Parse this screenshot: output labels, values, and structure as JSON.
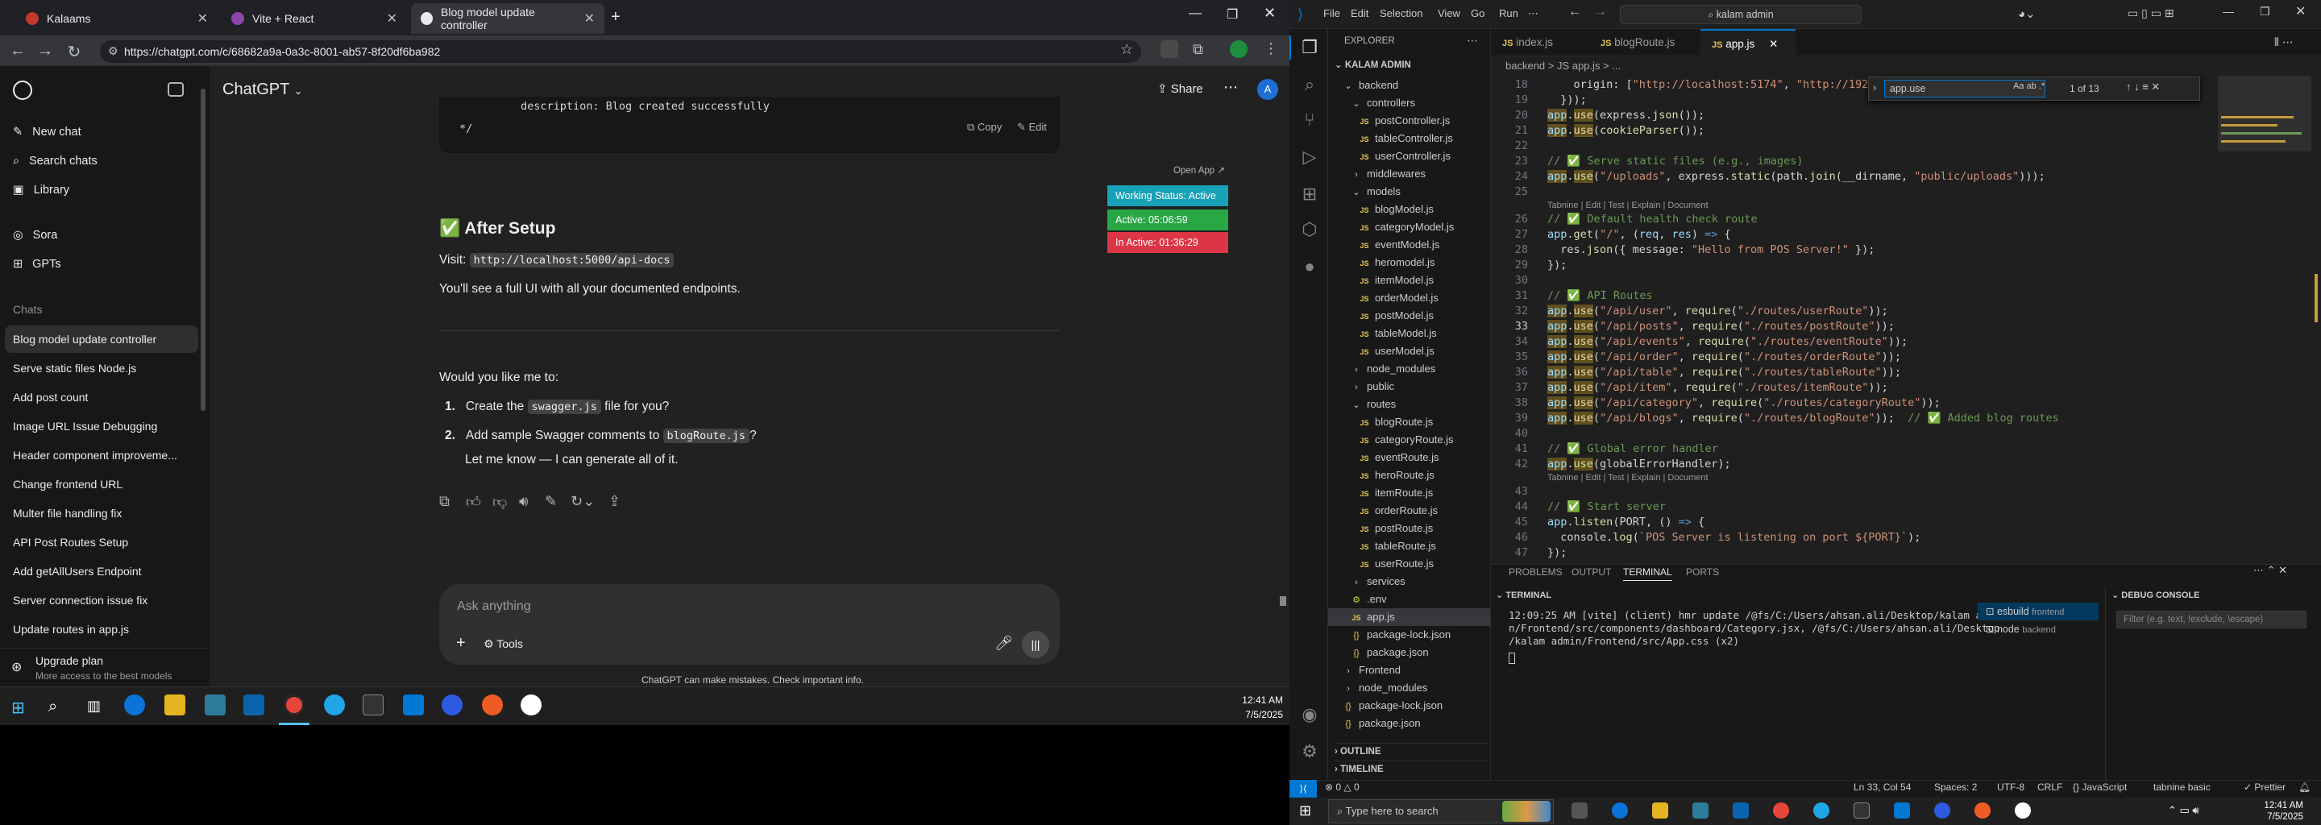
{
  "browser": {
    "tabs": [
      {
        "title": "Kalaams"
      },
      {
        "title": "Vite + React"
      },
      {
        "title": "Blog model update controller"
      }
    ],
    "url": "https://chatgpt.com/c/68682a9a-0a3c-8001-ab57-8f20df6ba982"
  },
  "sidebar": {
    "top_items": [
      {
        "label": "New chat",
        "icon": "compose-icon"
      },
      {
        "label": "Search chats",
        "icon": "search-icon"
      },
      {
        "label": "Library",
        "icon": "library-icon"
      },
      {
        "label": "Sora",
        "icon": "sora-icon"
      },
      {
        "label": "GPTs",
        "icon": "gpts-icon"
      }
    ],
    "section_label": "Chats",
    "chats": [
      "Blog model update controller",
      "Serve static files Node.js",
      "Add post count",
      "Image URL Issue Debugging",
      "Header component improveme...",
      "Change frontend URL",
      "Multer file handling fix",
      "API Post Routes Setup",
      "Add getAllUsers Endpoint",
      "Server connection issue fix",
      "Update routes in app.js"
    ],
    "upgrade_title": "Upgrade plan",
    "upgrade_sub": "More access to the best models"
  },
  "chat": {
    "model": "ChatGPT",
    "share": "Share",
    "code_tail_1": "description: Blog created successfully",
    "code_tail_2": "*/",
    "copy_label": "Copy",
    "edit_label": "Edit",
    "after_setup_title": "After Setup",
    "visit_prefix": "Visit:",
    "visit_url": "http://localhost:5000/api-docs",
    "see_line": "You'll see a full UI with all your documented endpoints.",
    "question": "Would you like me to:",
    "options": [
      {
        "num": "1.",
        "pre": "Create the ",
        "code": "swagger.js",
        "post": " file for you?"
      },
      {
        "num": "2.",
        "pre": "Add sample Swagger comments to ",
        "code": "blogRoute.js",
        "post": "?"
      }
    ],
    "closing": "Let me know — I can generate all of it.",
    "composer_placeholder": "Ask anything",
    "tools_label": "Tools",
    "disclaimer": "ChatGPT can make mistakes. Check important info."
  },
  "status_widget": {
    "open_app": "Open App ↗",
    "working": "Working Status: Active",
    "active": "Active: 05:06:59",
    "inactive": "In Active: 01:36:29"
  },
  "taskbar_left": {
    "time": "12:41 AM",
    "date": "7/5/2025"
  },
  "vscode": {
    "menu": [
      "File",
      "Edit",
      "Selection",
      "View",
      "Go",
      "Run"
    ],
    "search": "kalam admin",
    "explorer_title": "EXPLORER",
    "root": "KALAM ADMIN",
    "tree": [
      {
        "name": "backend",
        "type": "folder-open",
        "depth": 1
      },
      {
        "name": "controllers",
        "type": "folder-open",
        "depth": 2
      },
      {
        "name": "postController.js",
        "type": "js",
        "depth": 3
      },
      {
        "name": "tableController.js",
        "type": "js",
        "depth": 3
      },
      {
        "name": "userController.js",
        "type": "js",
        "depth": 3
      },
      {
        "name": "middlewares",
        "type": "folder",
        "depth": 2
      },
      {
        "name": "models",
        "type": "folder-open",
        "depth": 2
      },
      {
        "name": "blogModel.js",
        "type": "js",
        "depth": 3
      },
      {
        "name": "categoryModel.js",
        "type": "js",
        "depth": 3
      },
      {
        "name": "eventModel.js",
        "type": "js",
        "depth": 3
      },
      {
        "name": "heromodel.js",
        "type": "js",
        "depth": 3
      },
      {
        "name": "itemModel.js",
        "type": "js",
        "depth": 3
      },
      {
        "name": "orderModel.js",
        "type": "js",
        "depth": 3
      },
      {
        "name": "postModel.js",
        "type": "js",
        "depth": 3
      },
      {
        "name": "tableModel.js",
        "type": "js",
        "depth": 3
      },
      {
        "name": "userModel.js",
        "type": "js",
        "depth": 3
      },
      {
        "name": "node_modules",
        "type": "folder",
        "depth": 2
      },
      {
        "name": "public",
        "type": "folder",
        "depth": 2
      },
      {
        "name": "routes",
        "type": "folder-open",
        "depth": 2
      },
      {
        "name": "blogRoute.js",
        "type": "js",
        "depth": 3
      },
      {
        "name": "categoryRoute.js",
        "type": "js",
        "depth": 3
      },
      {
        "name": "eventRoute.js",
        "type": "js",
        "depth": 3
      },
      {
        "name": "heroRoute.js",
        "type": "js",
        "depth": 3
      },
      {
        "name": "itemRoute.js",
        "type": "js",
        "depth": 3
      },
      {
        "name": "orderRoute.js",
        "type": "js",
        "depth": 3
      },
      {
        "name": "postRoute.js",
        "type": "js",
        "depth": 3
      },
      {
        "name": "tableRoute.js",
        "type": "js",
        "depth": 3
      },
      {
        "name": "userRoute.js",
        "type": "js",
        "depth": 3
      },
      {
        "name": "services",
        "type": "folder",
        "depth": 2
      },
      {
        "name": ".env",
        "type": "env",
        "depth": 2
      },
      {
        "name": "app.js",
        "type": "js",
        "depth": 2,
        "selected": true
      },
      {
        "name": "package-lock.json",
        "type": "json",
        "depth": 2
      },
      {
        "name": "package.json",
        "type": "json",
        "depth": 2
      },
      {
        "name": "Frontend",
        "type": "folder",
        "depth": 1
      },
      {
        "name": "node_modules",
        "type": "folder",
        "depth": 1
      },
      {
        "name": "package-lock.json",
        "type": "json",
        "depth": 1
      },
      {
        "name": "package.json",
        "type": "json",
        "depth": 1
      }
    ],
    "outline": "OUTLINE",
    "timeline": "TIMELINE",
    "editor_tabs": [
      "index.js",
      "blogRoute.js",
      "app.js"
    ],
    "breadcrumb": "backend > JS app.js > ...",
    "find_query": "app.use",
    "find_count": "1 of 13",
    "panel_tabs": [
      "PROBLEMS",
      "OUTPUT",
      "TERMINAL",
      "PORTS"
    ],
    "terminals": [
      {
        "name": "esbuild",
        "sub": "frontend"
      },
      {
        "name": "node",
        "sub": "backend"
      }
    ],
    "debug_title": "DEBUG CONSOLE",
    "debug_filter": "Filter (e.g. text, !exclude, \\escape)",
    "terminal_lines": [
      "12:09:25 AM [vite] (client) hmr update /@fs/C:/Users/ahsan.ali/Desktop/kalam admi",
      "n/Frontend/src/components/dashboard/Category.jsx, /@fs/C:/Users/ahsan.ali/Desktop",
      "/kalam admin/Frontend/src/App.css (x2)"
    ],
    "statusbar": {
      "errors": "⊗ 0 △ 0",
      "cursor": "Ln 33, Col 54",
      "spaces": "Spaces: 2",
      "encoding": "UTF-8",
      "eol": "CRLF",
      "lang": "{} JavaScript",
      "tabnine": "tabnine basic",
      "prettier": "✓ Prettier"
    },
    "taskbar": {
      "search": "Type here to search",
      "time": "12:41 AM",
      "date": "7/5/2025"
    }
  },
  "code_lines": [
    {
      "n": "18",
      "spans": [
        [
          "n",
          "    origin: ["
        ],
        [
          "s",
          "\"http://localhost:5174\""
        ],
        [
          "n",
          ", "
        ],
        [
          "s",
          "\"http://192.168"
        ]
      ]
    },
    {
      "n": "19",
      "spans": [
        [
          "n",
          "  }));"
        ]
      ]
    },
    {
      "n": "20",
      "spans": [
        [
          "v",
          "app"
        ],
        [
          "n",
          "."
        ],
        [
          "f",
          "use"
        ],
        [
          "n",
          "(express."
        ],
        [
          "f",
          "json"
        ],
        [
          "n",
          "());"
        ]
      ]
    },
    {
      "n": "21",
      "spans": [
        [
          "v",
          "app"
        ],
        [
          "n",
          "."
        ],
        [
          "f",
          "use"
        ],
        [
          "n",
          "("
        ],
        [
          "f",
          "cookieParser"
        ],
        [
          "n",
          "());"
        ]
      ]
    },
    {
      "n": "22",
      "spans": [
        [
          "n",
          ""
        ]
      ]
    },
    {
      "n": "23",
      "spans": [
        [
          "c",
          "// ✅ Serve static files (e.g., images)"
        ]
      ]
    },
    {
      "n": "24",
      "spans": [
        [
          "v",
          "app"
        ],
        [
          "n",
          "."
        ],
        [
          "f",
          "use"
        ],
        [
          "n",
          "("
        ],
        [
          "s",
          "\"/uploads\""
        ],
        [
          "n",
          ", express."
        ],
        [
          "f",
          "static"
        ],
        [
          "n",
          "(path."
        ],
        [
          "f",
          "join"
        ],
        [
          "n",
          "(__dirname, "
        ],
        [
          "s",
          "\"public/uploads\""
        ],
        [
          "n",
          ")));"
        ]
      ]
    },
    {
      "n": "25",
      "spans": [
        [
          "n",
          ""
        ]
      ]
    },
    {
      "n": "26",
      "spans": [
        [
          "c",
          "// ✅ Default health check route"
        ]
      ]
    },
    {
      "n": "27",
      "spans": [
        [
          "v",
          "app"
        ],
        [
          "n",
          "."
        ],
        [
          "f",
          "get"
        ],
        [
          "n",
          "("
        ],
        [
          "s",
          "\"/\""
        ],
        [
          "n",
          ", ("
        ],
        [
          "v",
          "req"
        ],
        [
          "n",
          ", "
        ],
        [
          "v",
          "res"
        ],
        [
          "n",
          ") "
        ],
        [
          "k",
          "=>"
        ],
        [
          "n",
          " {"
        ]
      ]
    },
    {
      "n": "28",
      "spans": [
        [
          "n",
          "  res."
        ],
        [
          "f",
          "json"
        ],
        [
          "n",
          "({ message: "
        ],
        [
          "s",
          "\"Hello from POS Server!\""
        ],
        [
          "n",
          " });"
        ]
      ]
    },
    {
      "n": "29",
      "spans": [
        [
          "n",
          "});"
        ]
      ]
    },
    {
      "n": "30",
      "spans": [
        [
          "n",
          ""
        ]
      ]
    },
    {
      "n": "31",
      "spans": [
        [
          "c",
          "// ✅ API Routes"
        ]
      ]
    },
    {
      "n": "32",
      "spans": [
        [
          "v",
          "app"
        ],
        [
          "n",
          "."
        ],
        [
          "f",
          "use"
        ],
        [
          "n",
          "("
        ],
        [
          "s",
          "\"/api/user\""
        ],
        [
          "n",
          ", "
        ],
        [
          "f",
          "require"
        ],
        [
          "n",
          "("
        ],
        [
          "s",
          "\"./routes/userRoute\""
        ],
        [
          "n",
          "));"
        ]
      ]
    },
    {
      "n": "33",
      "spans": [
        [
          "v",
          "app"
        ],
        [
          "n",
          "."
        ],
        [
          "f",
          "use"
        ],
        [
          "n",
          "("
        ],
        [
          "s",
          "\"/api/posts\""
        ],
        [
          "n",
          ", "
        ],
        [
          "f",
          "require"
        ],
        [
          "n",
          "("
        ],
        [
          "s",
          "\"./routes/postRoute\""
        ],
        [
          "n",
          "));"
        ]
      ]
    },
    {
      "n": "34",
      "spans": [
        [
          "v",
          "app"
        ],
        [
          "n",
          "."
        ],
        [
          "f",
          "use"
        ],
        [
          "n",
          "("
        ],
        [
          "s",
          "\"/api/events\""
        ],
        [
          "n",
          ", "
        ],
        [
          "f",
          "require"
        ],
        [
          "n",
          "("
        ],
        [
          "s",
          "\"./routes/eventRoute\""
        ],
        [
          "n",
          "));"
        ]
      ]
    },
    {
      "n": "35",
      "spans": [
        [
          "v",
          "app"
        ],
        [
          "n",
          "."
        ],
        [
          "f",
          "use"
        ],
        [
          "n",
          "("
        ],
        [
          "s",
          "\"/api/order\""
        ],
        [
          "n",
          ", "
        ],
        [
          "f",
          "require"
        ],
        [
          "n",
          "("
        ],
        [
          "s",
          "\"./routes/orderRoute\""
        ],
        [
          "n",
          "));"
        ]
      ]
    },
    {
      "n": "36",
      "spans": [
        [
          "v",
          "app"
        ],
        [
          "n",
          "."
        ],
        [
          "f",
          "use"
        ],
        [
          "n",
          "("
        ],
        [
          "s",
          "\"/api/table\""
        ],
        [
          "n",
          ", "
        ],
        [
          "f",
          "require"
        ],
        [
          "n",
          "("
        ],
        [
          "s",
          "\"./routes/tableRoute\""
        ],
        [
          "n",
          "));"
        ]
      ]
    },
    {
      "n": "37",
      "spans": [
        [
          "v",
          "app"
        ],
        [
          "n",
          "."
        ],
        [
          "f",
          "use"
        ],
        [
          "n",
          "("
        ],
        [
          "s",
          "\"/api/item\""
        ],
        [
          "n",
          ", "
        ],
        [
          "f",
          "require"
        ],
        [
          "n",
          "("
        ],
        [
          "s",
          "\"./routes/itemRoute\""
        ],
        [
          "n",
          "));"
        ]
      ]
    },
    {
      "n": "38",
      "spans": [
        [
          "v",
          "app"
        ],
        [
          "n",
          "."
        ],
        [
          "f",
          "use"
        ],
        [
          "n",
          "("
        ],
        [
          "s",
          "\"/api/category\""
        ],
        [
          "n",
          ", "
        ],
        [
          "f",
          "require"
        ],
        [
          "n",
          "("
        ],
        [
          "s",
          "\"./routes/categoryRoute\""
        ],
        [
          "n",
          "));"
        ]
      ]
    },
    {
      "n": "39",
      "spans": [
        [
          "v",
          "app"
        ],
        [
          "n",
          "."
        ],
        [
          "f",
          "use"
        ],
        [
          "n",
          "("
        ],
        [
          "s",
          "\"/api/blogs\""
        ],
        [
          "n",
          ", "
        ],
        [
          "f",
          "require"
        ],
        [
          "n",
          "("
        ],
        [
          "s",
          "\"./routes/blogRoute\""
        ],
        [
          "n",
          "));  "
        ],
        [
          "c",
          "// ✅ Added blog routes"
        ]
      ]
    },
    {
      "n": "40",
      "spans": [
        [
          "n",
          ""
        ]
      ]
    },
    {
      "n": "41",
      "spans": [
        [
          "c",
          "// ✅ Global error handler"
        ]
      ]
    },
    {
      "n": "42",
      "spans": [
        [
          "v",
          "app"
        ],
        [
          "n",
          "."
        ],
        [
          "f",
          "use"
        ],
        [
          "n",
          "(globalErrorHandler);"
        ]
      ]
    },
    {
      "n": "43",
      "spans": [
        [
          "n",
          ""
        ]
      ]
    },
    {
      "n": "44",
      "spans": [
        [
          "c",
          "// ✅ Start server"
        ]
      ]
    },
    {
      "n": "45",
      "spans": [
        [
          "v",
          "app"
        ],
        [
          "n",
          "."
        ],
        [
          "f",
          "listen"
        ],
        [
          "n",
          "(PORT, () "
        ],
        [
          "k",
          "=>"
        ],
        [
          "n",
          " {"
        ]
      ]
    },
    {
      "n": "46",
      "spans": [
        [
          "n",
          "  console."
        ],
        [
          "f",
          "log"
        ],
        [
          "n",
          "("
        ],
        [
          "s",
          "`POS Server is listening on port ${PORT}`"
        ],
        [
          "n",
          ");"
        ]
      ]
    },
    {
      "n": "47",
      "spans": [
        [
          "n",
          "});"
        ]
      ]
    }
  ],
  "codelens": "Tabnine | Edit | Test | Explain | Document"
}
